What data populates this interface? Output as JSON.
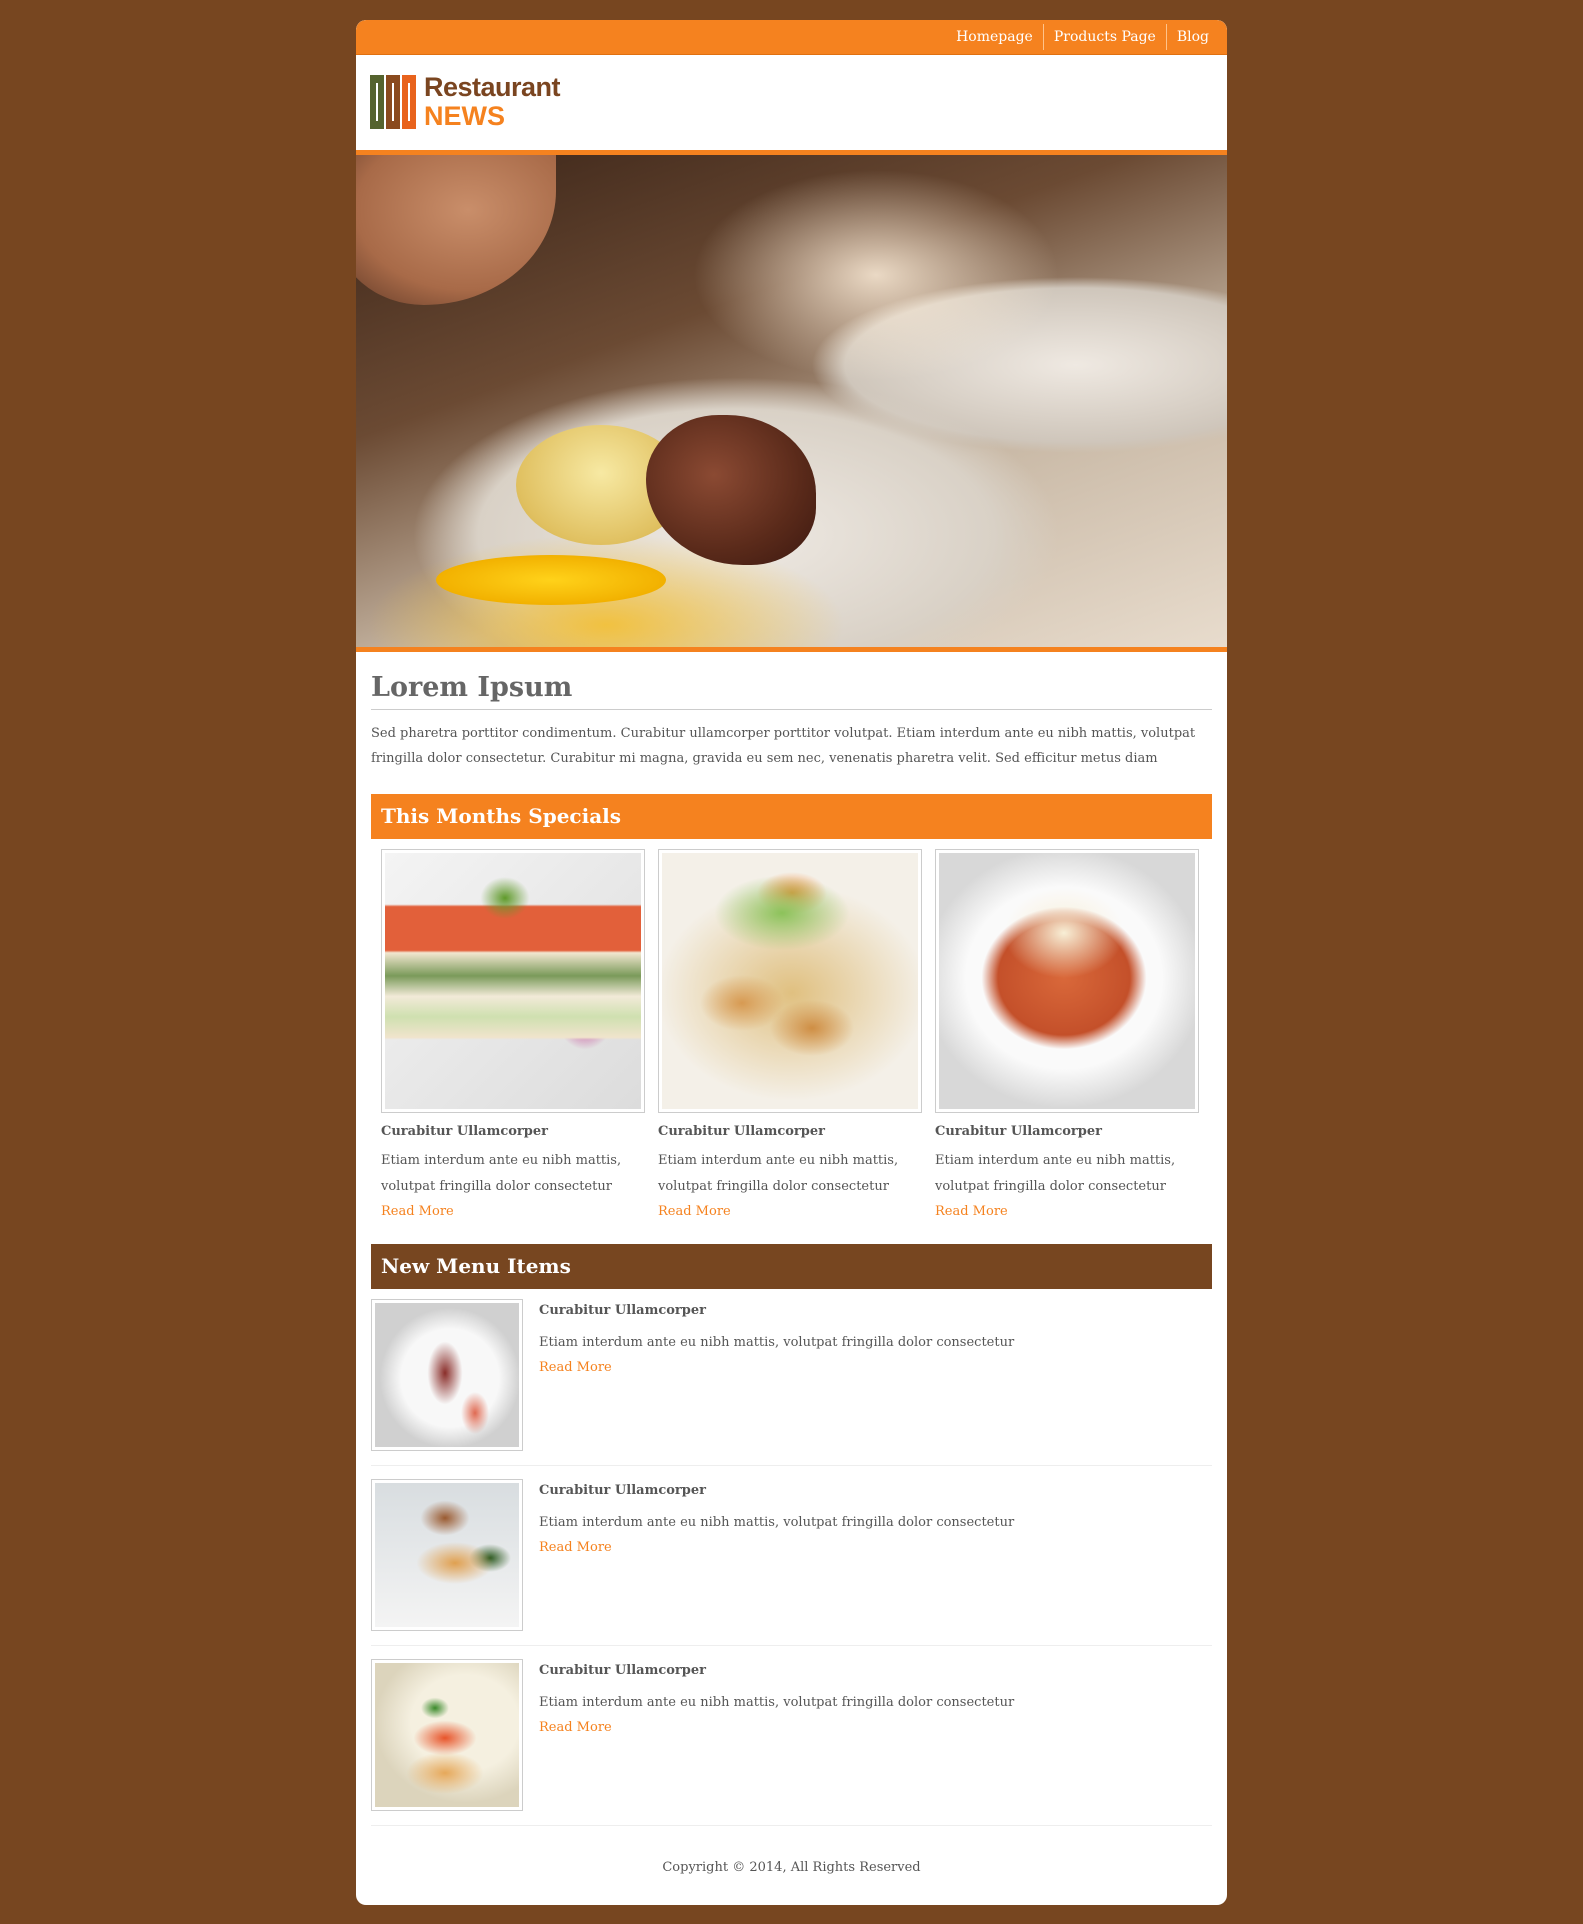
{
  "nav": {
    "links": [
      "Homepage",
      "Products Page",
      "Blog"
    ]
  },
  "logo": {
    "line1": "Restaurant",
    "line2": "NEWS"
  },
  "main": {
    "title": "Lorem Ipsum",
    "intro": "Sed pharetra porttitor condimentum. Curabitur ullamcorper porttitor volutpat. Etiam interdum ante eu nibh mattis, volutpat fringilla dolor consectetur. Curabitur mi magna, gravida eu sem nec, venenatis pharetra velit. Sed efficitur metus diam"
  },
  "specials": {
    "heading": "This Months Specials",
    "items": [
      {
        "title": "Curabitur Ullamcorper",
        "text": "Etiam interdum ante eu nibh mattis, volutpat fringilla dolor consectetur",
        "link": "Read More"
      },
      {
        "title": "Curabitur Ullamcorper",
        "text": "Etiam interdum ante eu nibh mattis, volutpat fringilla dolor consectetur",
        "link": "Read More"
      },
      {
        "title": "Curabitur Ullamcorper",
        "text": "Etiam interdum ante eu nibh mattis, volutpat fringilla dolor consectetur",
        "link": "Read More"
      }
    ]
  },
  "new_menu": {
    "heading": "New Menu Items",
    "items": [
      {
        "title": "Curabitur Ullamcorper",
        "text": "Etiam interdum ante eu nibh mattis, volutpat fringilla dolor consectetur",
        "link": "Read More"
      },
      {
        "title": "Curabitur Ullamcorper",
        "text": "Etiam interdum ante eu nibh mattis, volutpat fringilla dolor consectetur",
        "link": "Read More"
      },
      {
        "title": "Curabitur Ullamcorper",
        "text": "Etiam interdum ante eu nibh mattis, volutpat fringilla dolor consectetur",
        "link": "Read More"
      }
    ]
  },
  "footer": {
    "copyright": "Copyright © 2014, All Rights Reserved"
  },
  "colors": {
    "page_background": "#774620",
    "accent_orange": "#f5821f",
    "accent_brown": "#774620"
  }
}
